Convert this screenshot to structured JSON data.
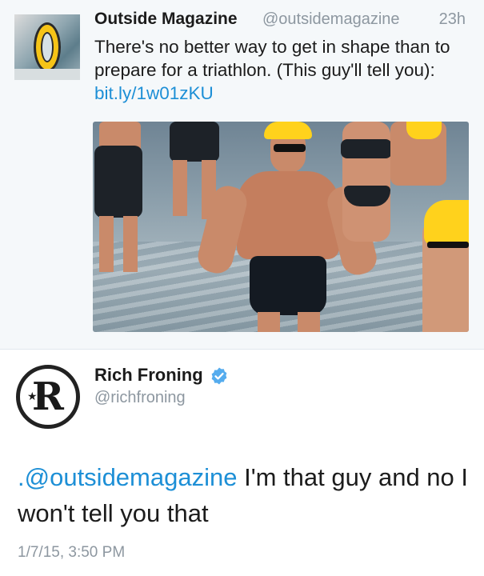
{
  "top_tweet": {
    "name": "Outside Magazine",
    "handle": "@outsidemagazine",
    "time": "23h",
    "text": "There's no better way to get in shape than to prepare for a triathlon. (This guy'll tell you): ",
    "link": "bit.ly/1w01zKU",
    "avatar_icon": "outside-magazine-logo",
    "media_description_icon": "triathlon-photo"
  },
  "reply_tweet": {
    "name": "Rich Froning",
    "handle": "@richfroning",
    "verified_icon": "verified-badge-icon",
    "mention": ".@outsidemagazine",
    "text": " I'm that guy and no I won't tell you that",
    "timestamp": "1/7/15, 3:50 PM"
  },
  "colors": {
    "link": "#1d8fd6",
    "muted": "#8d97a0",
    "top_background": "#f5f8fa",
    "verified": "#55acee"
  }
}
